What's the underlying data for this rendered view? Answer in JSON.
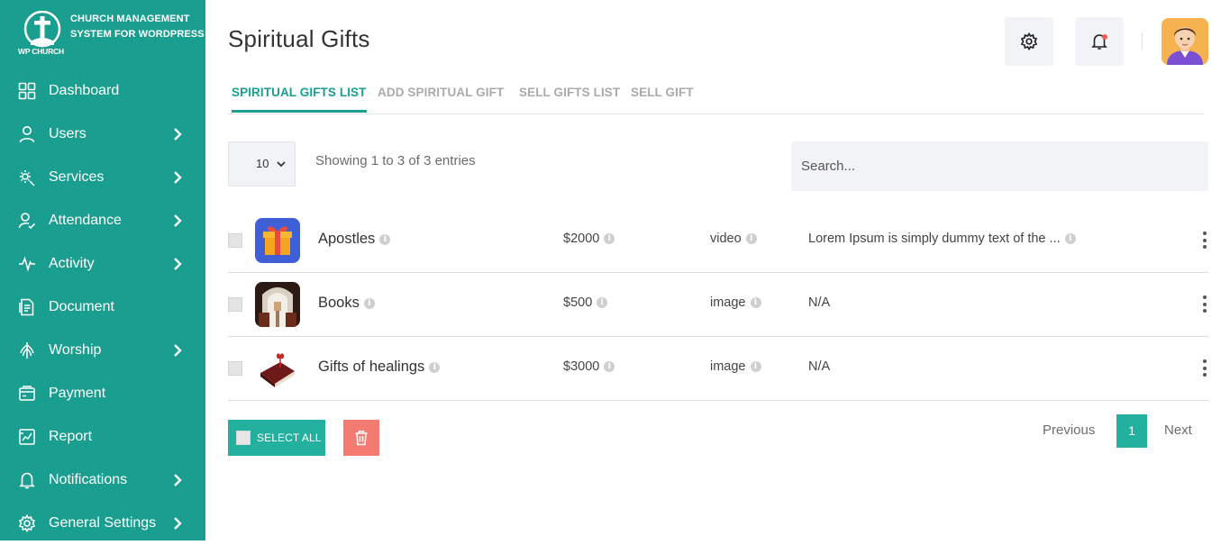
{
  "brand": {
    "title": "CHURCH MANAGEMENT SYSTEM FOR WORDPRESS",
    "logo_text": "WP CHURCH"
  },
  "sidebar": {
    "items": [
      {
        "label": "Dashboard",
        "icon": "dashboard-icon",
        "has_submenu": false
      },
      {
        "label": "Users",
        "icon": "user-icon",
        "has_submenu": true
      },
      {
        "label": "Services",
        "icon": "services-icon",
        "has_submenu": true
      },
      {
        "label": "Attendance",
        "icon": "attendance-icon",
        "has_submenu": true
      },
      {
        "label": "Activity",
        "icon": "activity-icon",
        "has_submenu": true
      },
      {
        "label": "Document",
        "icon": "document-icon",
        "has_submenu": false
      },
      {
        "label": "Worship",
        "icon": "worship-icon",
        "has_submenu": true
      },
      {
        "label": "Payment",
        "icon": "payment-icon",
        "has_submenu": false
      },
      {
        "label": "Report",
        "icon": "report-icon",
        "has_submenu": false
      },
      {
        "label": "Notifications",
        "icon": "bell-icon",
        "has_submenu": true
      },
      {
        "label": "General Settings",
        "icon": "gear-icon",
        "has_submenu": true
      }
    ]
  },
  "header": {
    "title": "Spiritual Gifts"
  },
  "tabs": [
    {
      "label": "SPIRITUAL GIFTS LIST",
      "active": true
    },
    {
      "label": "ADD SPIRITUAL GIFT",
      "active": false
    },
    {
      "label": "SELL GIFTS LIST",
      "active": false
    },
    {
      "label": "SELL GIFT",
      "active": false
    }
  ],
  "table_controls": {
    "page_length": "10",
    "info": "Showing 1 to 3 of 3 entries",
    "search_placeholder": "Search..."
  },
  "rows": [
    {
      "name": "Apostles",
      "price": "$2000",
      "type": "video",
      "description": "Lorem Ipsum is simply dummy text of the ...",
      "thumb": "gift-box-icon"
    },
    {
      "name": "Books",
      "price": "$500",
      "type": "image",
      "description": "N/A",
      "thumb": "church-interior-image"
    },
    {
      "name": "Gifts of healings",
      "price": "$3000",
      "type": "image",
      "description": "N/A",
      "thumb": "bible-image"
    }
  ],
  "footer": {
    "select_all": "SELECT ALL",
    "previous": "Previous",
    "current_page": "1",
    "next": "Next"
  },
  "colors": {
    "sidebar": "#1a9e8f",
    "accent": "#23b09e",
    "delete": "#f37b72"
  }
}
